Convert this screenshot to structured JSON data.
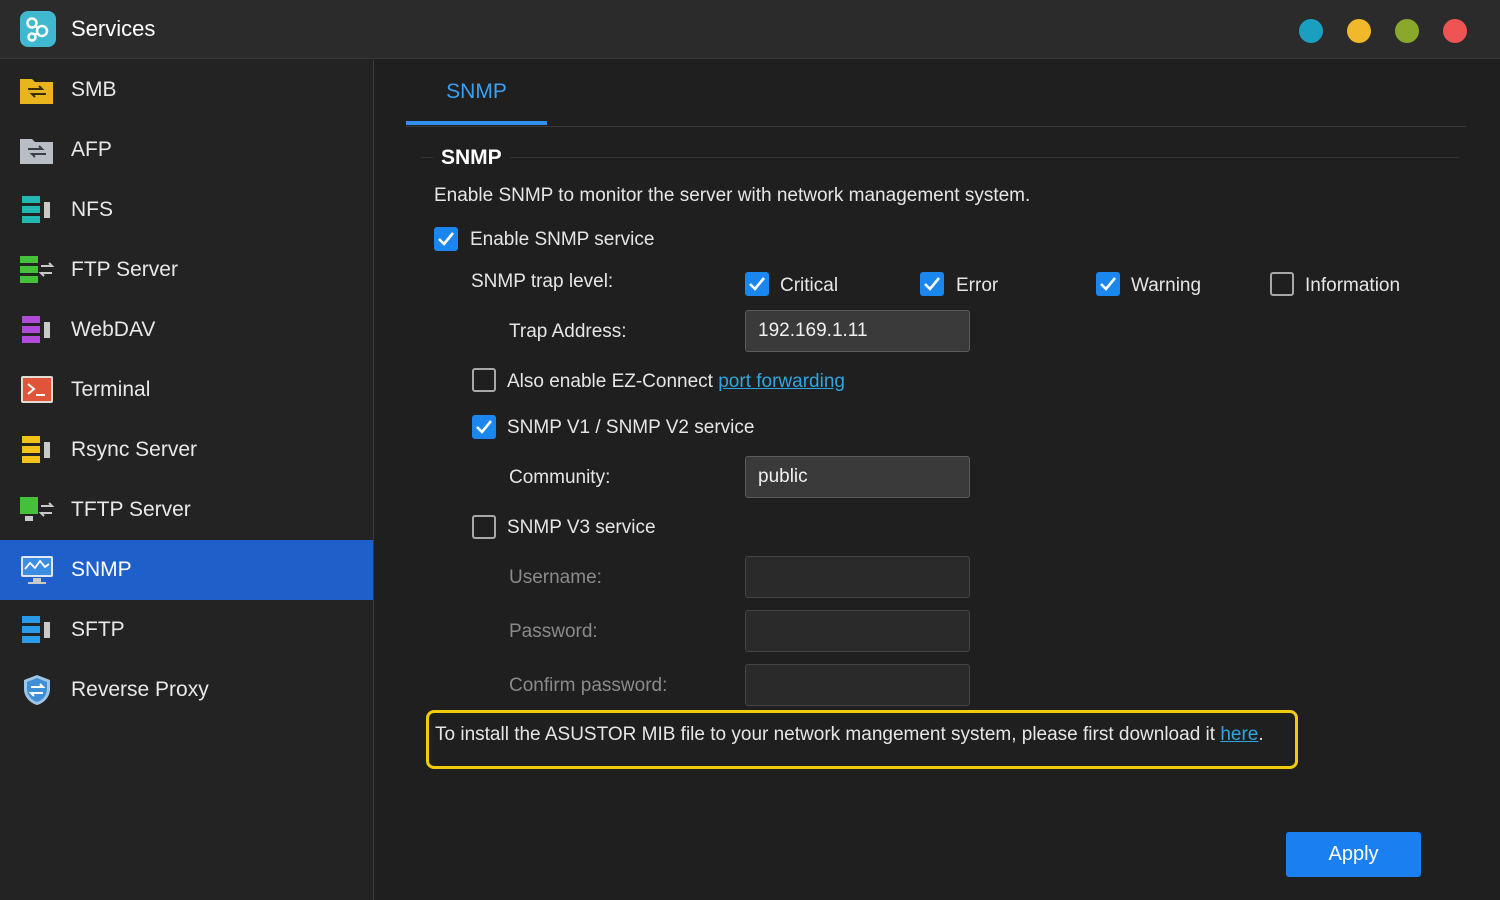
{
  "window": {
    "title": "Services",
    "controls": [
      {
        "name": "window-teal-button",
        "color": "#1a9fc0"
      },
      {
        "name": "window-minimize-button",
        "color": "#f2b82c"
      },
      {
        "name": "window-maximize-button",
        "color": "#8aa82c"
      },
      {
        "name": "window-close-button",
        "color": "#ee5454"
      }
    ]
  },
  "sidebar": {
    "items": [
      {
        "label": "SMB",
        "icon": "smb-folder-icon",
        "active": false
      },
      {
        "label": "AFP",
        "icon": "afp-folder-icon",
        "active": false
      },
      {
        "label": "NFS",
        "icon": "nfs-server-icon",
        "active": false
      },
      {
        "label": "FTP Server",
        "icon": "ftp-server-icon",
        "active": false
      },
      {
        "label": "WebDAV",
        "icon": "webdav-server-icon",
        "active": false
      },
      {
        "label": "Terminal",
        "icon": "terminal-icon",
        "active": false
      },
      {
        "label": "Rsync Server",
        "icon": "rsync-server-icon",
        "active": false
      },
      {
        "label": "TFTP Server",
        "icon": "tftp-server-icon",
        "active": false
      },
      {
        "label": "SNMP",
        "icon": "snmp-monitor-icon",
        "active": true
      },
      {
        "label": "SFTP",
        "icon": "sftp-server-icon",
        "active": false
      },
      {
        "label": "Reverse Proxy",
        "icon": "shield-icon",
        "active": false
      }
    ]
  },
  "tabs": [
    {
      "label": "SNMP",
      "active": true
    }
  ],
  "snmp": {
    "section_title": "SNMP",
    "description": "Enable SNMP to monitor the server with network management system.",
    "enable_label": "Enable SNMP service",
    "enable_checked": true,
    "trap_level_label": "SNMP trap level:",
    "trap_levels": [
      {
        "label": "Critical",
        "checked": true
      },
      {
        "label": "Error",
        "checked": true
      },
      {
        "label": "Warning",
        "checked": true
      },
      {
        "label": "Information",
        "checked": false
      }
    ],
    "trap_address_label": "Trap Address:",
    "trap_address_value": "192.169.1.11",
    "ezconnect_label": "Also enable EZ-Connect",
    "ezconnect_link": "port forwarding",
    "ezconnect_checked": false,
    "v1v2_label": "SNMP V1 / SNMP V2 service",
    "v1v2_checked": true,
    "community_label": "Community:",
    "community_value": "public",
    "v3_label": "SNMP V3 service",
    "v3_checked": false,
    "username_label": "Username:",
    "password_label": "Password:",
    "confirm_password_label": "Confirm password:",
    "mib_notice_text": "To install the ASUSTOR MIB file to your network mangement system, please first download it",
    "mib_notice_link": "here",
    "mib_notice_end": "."
  },
  "footer": {
    "apply_label": "Apply"
  }
}
